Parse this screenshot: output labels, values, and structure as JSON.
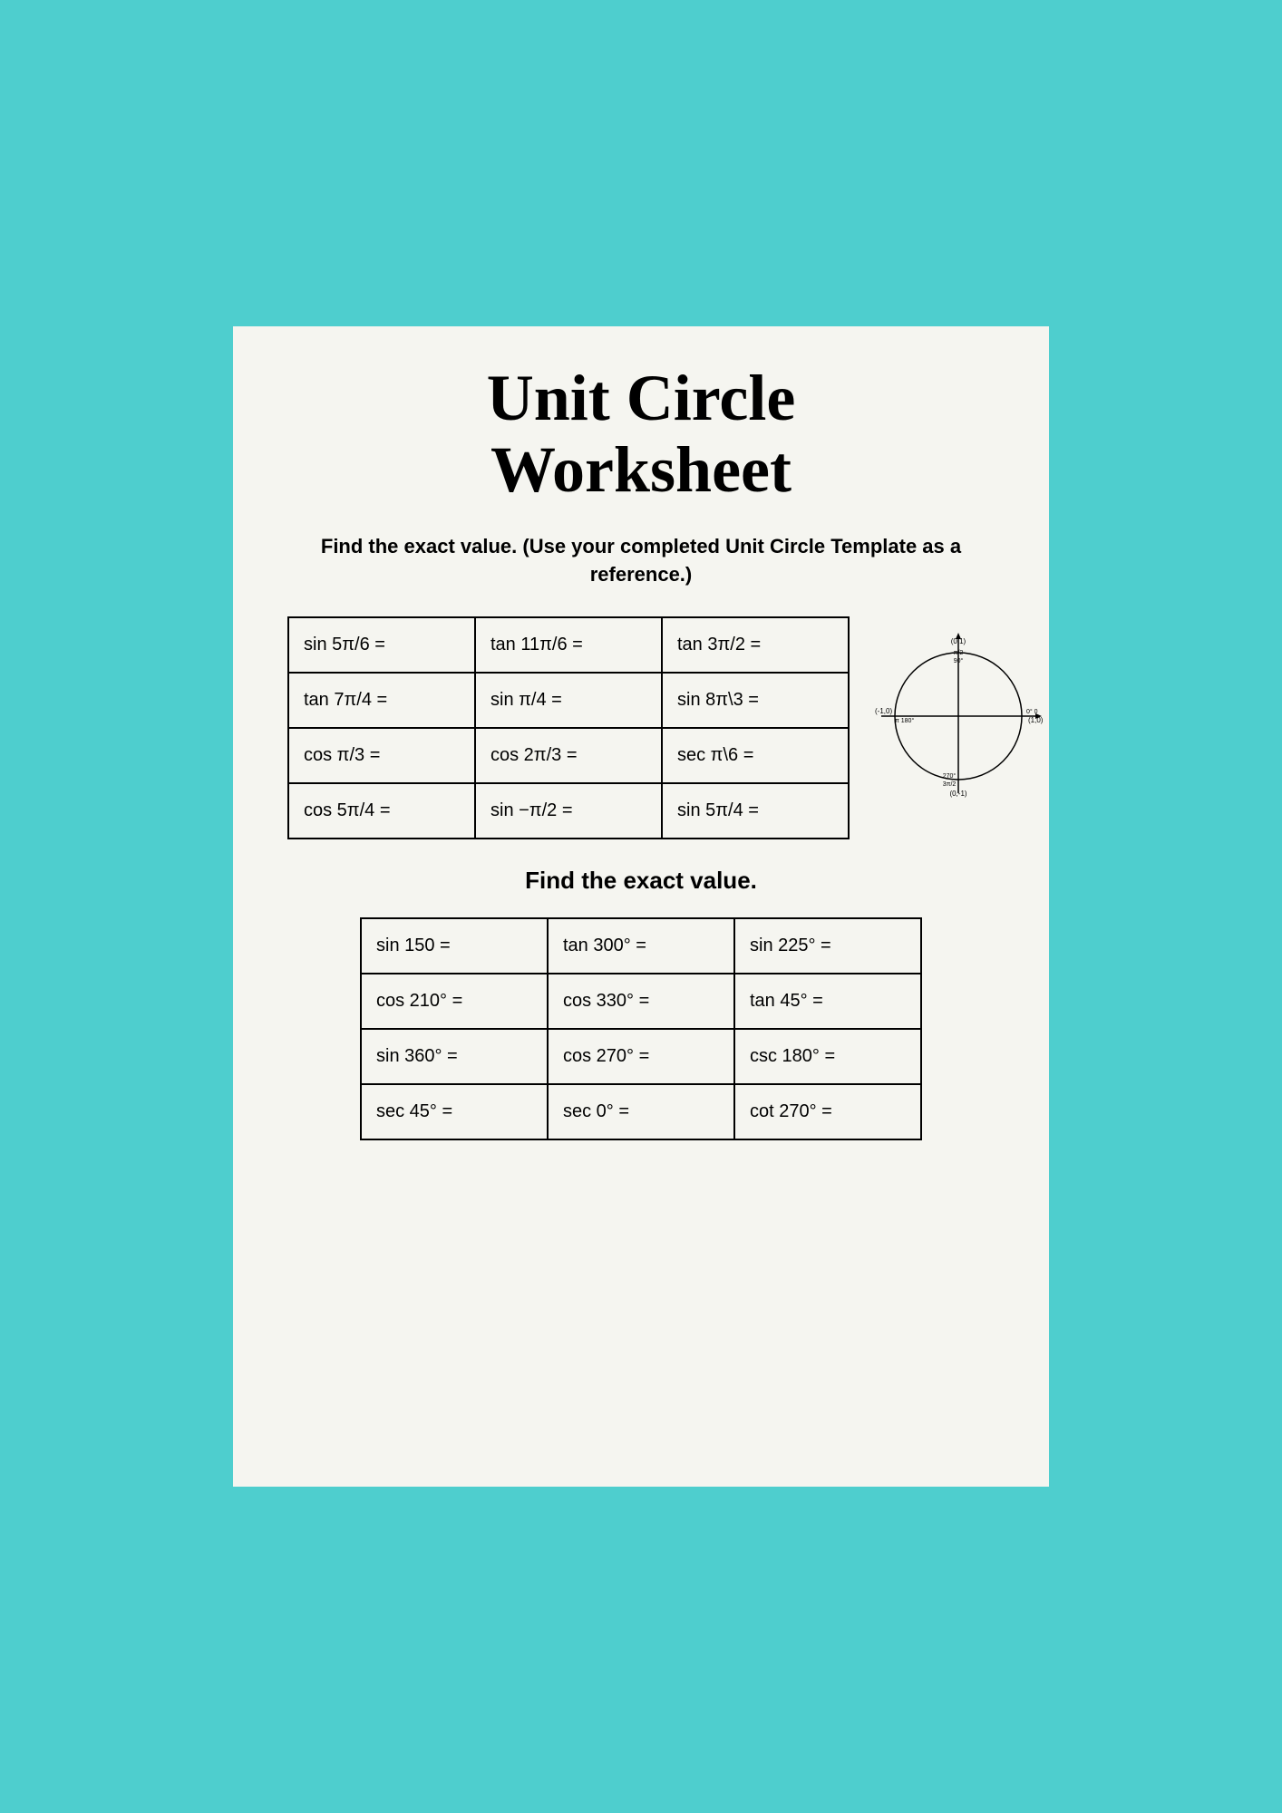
{
  "title": "Unit Circle\nWorksheet",
  "subtitle": "Find the exact value. (Use your completed Unit Circle Template as a reference.)",
  "section2_label": "Find the exact value.",
  "table1": {
    "rows": [
      [
        "sin 5π/6 =",
        "tan 11π/6 =",
        "tan 3π/2 ="
      ],
      [
        "tan 7π/4 =",
        "sin π/4 =",
        "sin 8π\\3 ="
      ],
      [
        "cos π/3 =",
        "cos 2π/3 =",
        "sec π\\6 ="
      ],
      [
        "cos 5π/4 =",
        "sin −π/2 =",
        "sin 5π/4 ="
      ]
    ]
  },
  "table2": {
    "rows": [
      [
        "sin 150 =",
        "tan 300° =",
        "sin 225° ="
      ],
      [
        "cos 210° =",
        "cos 330° =",
        "tan 45° ="
      ],
      [
        "sin 360° =",
        "cos 270° =",
        "csc 180° ="
      ],
      [
        "sec 45° =",
        "sec 0° =",
        "cot 270° ="
      ]
    ]
  },
  "circle": {
    "label_top": "(0,1)",
    "label_right": "(1,0)",
    "label_left": "(-1,0)",
    "label_bottom": "(0,-1)",
    "angle_90": "π/2\n90°",
    "angle_180": "π 180°",
    "angle_270": "270°\n3π\n2",
    "angle_0": "0° 0"
  }
}
